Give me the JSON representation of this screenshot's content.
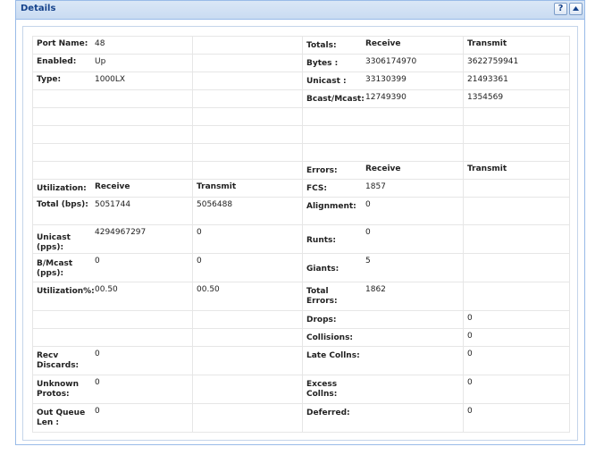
{
  "panel": {
    "title": "Details",
    "help_icon": "?",
    "collapse_icon": "chevron-up-icon"
  },
  "port": {
    "name_label": "Port Name:",
    "name_value": "48",
    "enabled_label": "Enabled:",
    "enabled_value": "Up",
    "type_label": "Type:",
    "type_value": "1000LX"
  },
  "totals": {
    "header_label": "Totals:",
    "receive_header": "Receive",
    "transmit_header": "Transmit",
    "rows": [
      {
        "label": "Bytes :",
        "receive": "3306174970",
        "transmit": "3622759941"
      },
      {
        "label": "Unicast :",
        "receive": "33130399",
        "transmit": "21493361"
      },
      {
        "label": "Bcast/Mcast:",
        "receive": "12749390",
        "transmit": "1354569"
      }
    ]
  },
  "utilization": {
    "header_label": "Utilization:",
    "receive_header": "Receive",
    "transmit_header": "Transmit",
    "rows": [
      {
        "label": "Total (bps):",
        "receive": "5051744",
        "transmit": "5056488"
      },
      {
        "label": "Unicast (pps):",
        "receive": "4294967297",
        "transmit": "0"
      },
      {
        "label": "B/Mcast (pps):",
        "receive": "0",
        "transmit": "0"
      },
      {
        "label": "Utilization%:",
        "receive": "00.50",
        "transmit": "00.50"
      }
    ]
  },
  "errors": {
    "header_label": "Errors:",
    "receive_header": "Receive",
    "transmit_header": "Transmit",
    "rows": [
      {
        "label": "FCS:",
        "receive": "1857",
        "transmit": ""
      },
      {
        "label": "Alignment:",
        "receive": "0",
        "transmit": ""
      },
      {
        "label": "Runts:",
        "receive": "0",
        "transmit": ""
      },
      {
        "label": "Giants:",
        "receive": "5",
        "transmit": ""
      },
      {
        "label": "Total Errors:",
        "receive": "1862",
        "transmit": ""
      },
      {
        "label": "Drops:",
        "receive": "",
        "transmit": "0"
      },
      {
        "label": "Collisions:",
        "receive": "",
        "transmit": "0"
      },
      {
        "label": "Late Collns:",
        "receive": "",
        "transmit": "0"
      },
      {
        "label": "Excess Collns:",
        "receive": "",
        "transmit": "0"
      },
      {
        "label": "Deferred:",
        "receive": "",
        "transmit": "0"
      }
    ]
  },
  "discards": {
    "rows": [
      {
        "label": "Recv Discards:",
        "value": "0"
      },
      {
        "label": "Unknown Protos:",
        "value": "0"
      },
      {
        "label": "Out Queue Len :",
        "value": "0"
      }
    ]
  }
}
